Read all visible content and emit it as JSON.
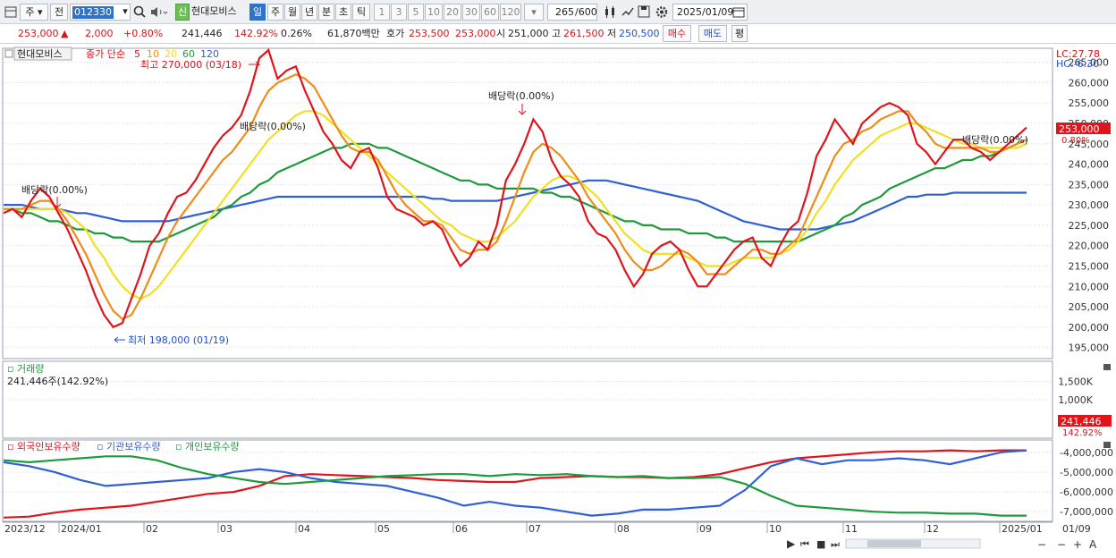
{
  "toolbar": {
    "period_options": [
      "주",
      "전"
    ],
    "stock_code": "012330",
    "badge": "신",
    "stock_name": "현대모비스",
    "intervals": [
      "일",
      "주",
      "월",
      "년",
      "분",
      "초",
      "틱"
    ],
    "interval_active": "일",
    "minute_options": [
      "1",
      "3",
      "5",
      "10",
      "20",
      "30",
      "60",
      "120"
    ],
    "count_current": "265",
    "count_total": "/600",
    "date": "2025/01/09"
  },
  "quote": {
    "price": "253,000",
    "change": "2,000",
    "change_pct": "+0.80%",
    "volume": "241,446",
    "volume_ratio": "142.92%",
    "turnover": "0.26%",
    "amount": "61,870백만",
    "ask_label": "호가",
    "ask": "253,500",
    "bid": "253,000",
    "open_label": "시",
    "open": "251,000",
    "high_label": "고",
    "high": "261,500",
    "low_label": "저",
    "low": "250,500",
    "buy_label": "매수",
    "sell_label": "매도",
    "even_label": "평"
  },
  "chart_data": [
    {
      "type": "candlestick",
      "legend": {
        "name": "현대모비스",
        "items": [
          "종가 단순",
          "5",
          "10",
          "20",
          "60",
          "120"
        ]
      },
      "x_ticks": [
        "2023/12",
        "2024/01",
        "02",
        "03",
        "04",
        "05",
        "06",
        "07",
        "08",
        "09",
        "10",
        "11",
        "12",
        "2025/01",
        "01/09"
      ],
      "y_ticks": [
        "265,000",
        "260,000",
        "255,000",
        "250,000",
        "245,000",
        "240,000",
        "235,000",
        "230,000",
        "225,000",
        "220,000",
        "215,000",
        "210,000",
        "205,000",
        "200,000",
        "195,000"
      ],
      "ylim": [
        192500,
        268000
      ],
      "lc_label": "LC:27.78",
      "hc_label": "HC:-6.30",
      "price_label": "253,000",
      "price_pct": "0.80%",
      "annotations": {
        "high": "최고 270,000 (03/18)",
        "low": "최저 198,000 (01/19)",
        "dividend": "배당락(0.00%)"
      },
      "colors": {
        "up": "#e0141b",
        "down": "#1f4fd1",
        "ma5": "#e0141b",
        "ma10": "#f08c18",
        "ma20": "#f0e020",
        "ma60": "#1e9a3c",
        "ma120": "#2f5fd8"
      },
      "ma5": [
        228000,
        229000,
        227000,
        231000,
        234000,
        232000,
        228000,
        224000,
        219000,
        214000,
        208000,
        203000,
        200000,
        201000,
        207000,
        213000,
        220000,
        223000,
        228000,
        232000,
        233000,
        236000,
        240000,
        244000,
        247000,
        249000,
        252000,
        258000,
        266000,
        268000,
        261000,
        263000,
        264000,
        258000,
        253000,
        248000,
        245000,
        241000,
        239000,
        243000,
        244000,
        239000,
        232000,
        229000,
        228000,
        227000,
        225000,
        226000,
        224000,
        219000,
        215000,
        217000,
        221000,
        219000,
        225000,
        236000,
        240000,
        245000,
        251000,
        248000,
        241000,
        237000,
        235000,
        232000,
        226000,
        223000,
        222000,
        219000,
        214000,
        210000,
        213000,
        218000,
        220000,
        221000,
        219000,
        214000,
        210000,
        210000,
        213000,
        216000,
        219000,
        221000,
        222000,
        217000,
        215000,
        220000,
        224000,
        226000,
        233000,
        242000,
        246000,
        251000,
        248000,
        245000,
        250000,
        252000,
        254000,
        255000,
        254000,
        252000,
        245000,
        243000,
        240000,
        243000,
        246000,
        246000,
        244000,
        243000,
        241000,
        243000,
        245000,
        247000,
        249000
      ],
      "ma10": [
        229000,
        229000,
        229000,
        230000,
        231000,
        231000,
        229000,
        226000,
        222000,
        218000,
        213000,
        208000,
        204000,
        202000,
        203000,
        207000,
        212000,
        217000,
        222000,
        226000,
        229000,
        232000,
        235000,
        238000,
        241000,
        243000,
        246000,
        249000,
        254000,
        258000,
        260000,
        261000,
        262000,
        261000,
        259000,
        255000,
        251000,
        247000,
        244000,
        243000,
        243000,
        241000,
        237000,
        233000,
        230000,
        228000,
        226000,
        226000,
        225000,
        222000,
        219000,
        218000,
        219000,
        219000,
        221000,
        226000,
        232000,
        238000,
        243000,
        245000,
        244000,
        242000,
        239000,
        236000,
        232000,
        229000,
        226000,
        223000,
        219000,
        216000,
        214000,
        214000,
        215000,
        217000,
        219000,
        218000,
        216000,
        213000,
        213000,
        213000,
        215000,
        217000,
        219000,
        219000,
        218000,
        218000,
        220000,
        222000,
        227000,
        232000,
        237000,
        242000,
        245000,
        246000,
        248000,
        249000,
        251000,
        252000,
        253000,
        253000,
        250000,
        248000,
        245000,
        244000,
        244000,
        244000,
        244000,
        244000,
        243000,
        243000,
        244000,
        245000,
        246000
      ],
      "ma20": [
        229000,
        229000,
        229000,
        229000,
        229000,
        229000,
        229000,
        228000,
        226000,
        224000,
        220000,
        217000,
        213000,
        210000,
        208000,
        207000,
        208000,
        210000,
        213000,
        216000,
        219000,
        222000,
        225000,
        228000,
        231000,
        234000,
        237000,
        240000,
        243000,
        246000,
        248000,
        250000,
        252000,
        253000,
        253000,
        252000,
        250000,
        248000,
        246000,
        244000,
        242000,
        240000,
        238000,
        236000,
        234000,
        232000,
        230000,
        228000,
        226000,
        225000,
        223000,
        222000,
        221000,
        221000,
        222000,
        224000,
        226000,
        229000,
        232000,
        234000,
        236000,
        237000,
        237000,
        236000,
        234000,
        232000,
        229000,
        226000,
        223000,
        221000,
        219000,
        218000,
        218000,
        218000,
        218000,
        217000,
        216000,
        215000,
        215000,
        215000,
        216000,
        217000,
        217000,
        217000,
        217000,
        218000,
        219000,
        221000,
        224000,
        228000,
        231000,
        235000,
        238000,
        241000,
        243000,
        245000,
        247000,
        248000,
        249000,
        250000,
        250000,
        249000,
        248000,
        247000,
        246000,
        245000,
        245000,
        244000,
        244000,
        244000,
        244000,
        244000,
        245000
      ],
      "ma60": [
        229000,
        229000,
        228000,
        228000,
        227000,
        226000,
        226000,
        225000,
        224000,
        224000,
        223000,
        223000,
        222000,
        222000,
        221000,
        221000,
        221000,
        221000,
        222000,
        223000,
        224000,
        225000,
        226000,
        227000,
        229000,
        230000,
        232000,
        233000,
        235000,
        236000,
        238000,
        239000,
        240000,
        241000,
        242000,
        243000,
        244000,
        244000,
        245000,
        245000,
        245000,
        244000,
        244000,
        243000,
        242000,
        241000,
        240000,
        239000,
        238000,
        237000,
        236000,
        236000,
        235000,
        235000,
        234000,
        234000,
        234000,
        234000,
        234000,
        233000,
        233000,
        232000,
        232000,
        231000,
        230000,
        229000,
        228000,
        227000,
        226000,
        226000,
        225000,
        225000,
        224000,
        224000,
        224000,
        223000,
        223000,
        223000,
        222000,
        222000,
        221000,
        221000,
        221000,
        221000,
        221000,
        221000,
        221000,
        221000,
        222000,
        223000,
        224000,
        225000,
        227000,
        228000,
        230000,
        231000,
        232000,
        234000,
        235000,
        236000,
        237000,
        238000,
        239000,
        239000,
        240000,
        241000,
        241000,
        242000,
        242000,
        243000,
        244000,
        245000,
        246000
      ],
      "ma120": [
        230000,
        230000,
        230000,
        229500,
        229000,
        229000,
        229000,
        228500,
        228000,
        228000,
        227500,
        227000,
        226500,
        226000,
        226000,
        226000,
        226000,
        226000,
        226000,
        226500,
        227000,
        227500,
        228000,
        228500,
        229000,
        229500,
        230000,
        230500,
        231000,
        231500,
        232000,
        232000,
        232000,
        232000,
        232000,
        232000,
        232000,
        232000,
        232000,
        232000,
        232000,
        232000,
        232000,
        232000,
        232000,
        232000,
        232000,
        231500,
        231500,
        231000,
        231000,
        231000,
        231000,
        231000,
        231000,
        231500,
        232000,
        232500,
        233000,
        233500,
        234000,
        234500,
        235000,
        235500,
        236000,
        236000,
        236000,
        235500,
        235000,
        234500,
        234000,
        233500,
        233000,
        232500,
        232000,
        231500,
        231000,
        230000,
        229000,
        228000,
        227000,
        226000,
        225500,
        225000,
        224500,
        224000,
        224000,
        224000,
        224000,
        224000,
        224500,
        225000,
        225500,
        226000,
        227000,
        228000,
        229000,
        230000,
        231000,
        232000,
        232000,
        232500,
        232500,
        232500,
        233000,
        233000,
        233000,
        233000,
        233000,
        233000,
        233000,
        233000,
        233000
      ]
    },
    {
      "type": "bar",
      "title": "거래량",
      "value_label": "241,446주(142.92%)",
      "y_ticks": [
        "1,500K",
        "1,000K"
      ],
      "ylim": [
        0,
        2000000
      ],
      "current_label": "241,446",
      "current_pct": "142.92%",
      "spike_position": 0.465,
      "typical_fill": 0.12
    },
    {
      "type": "line",
      "legend": [
        "외국인보유수량",
        "기관보유수량",
        "개인보유수량"
      ],
      "colors": [
        "#e0141b",
        "#2f5fd8",
        "#1e9a3c"
      ],
      "y_ticks": [
        "-4,000,000",
        "-5,000,000",
        "-6,000,000",
        "-7,000,000"
      ],
      "ylim": [
        -7400000,
        -3600000
      ],
      "series": [
        {
          "name": "외국인보유수량",
          "values": [
            -7300000,
            -7250000,
            -7050000,
            -6900000,
            -6800000,
            -6700000,
            -6500000,
            -6300000,
            -6100000,
            -6000000,
            -5700000,
            -5200000,
            -5100000,
            -5150000,
            -5200000,
            -5250000,
            -5300000,
            -5400000,
            -5450000,
            -5500000,
            -5500000,
            -5300000,
            -5250000,
            -5200000,
            -5250000,
            -5250000,
            -5300000,
            -5250000,
            -5100000,
            -4800000,
            -4500000,
            -4300000,
            -4200000,
            -4100000,
            -4000000,
            -3950000,
            -3950000,
            -3900000,
            -3950000,
            -3900000,
            -3900000
          ]
        },
        {
          "name": "기관보유수량",
          "values": [
            -4500000,
            -4700000,
            -5000000,
            -5400000,
            -5700000,
            -5600000,
            -5500000,
            -5400000,
            -5300000,
            -5000000,
            -4850000,
            -5000000,
            -5300000,
            -5500000,
            -5600000,
            -5700000,
            -6000000,
            -6300000,
            -6700000,
            -6500000,
            -6700000,
            -6800000,
            -7000000,
            -7200000,
            -7100000,
            -6900000,
            -6900000,
            -6800000,
            -6700000,
            -5900000,
            -4700000,
            -4300000,
            -4600000,
            -4400000,
            -4400000,
            -4300000,
            -4400000,
            -4600000,
            -4300000,
            -4000000,
            -3900000
          ]
        },
        {
          "name": "개인보유수량",
          "values": [
            -4400000,
            -4500000,
            -4400000,
            -4300000,
            -4200000,
            -4200000,
            -4400000,
            -4800000,
            -5100000,
            -5300000,
            -5500000,
            -5600000,
            -5500000,
            -5400000,
            -5300000,
            -5200000,
            -5150000,
            -5100000,
            -5100000,
            -5200000,
            -5100000,
            -5150000,
            -5100000,
            -5200000,
            -5250000,
            -5200000,
            -5300000,
            -5300000,
            -5250000,
            -5600000,
            -6200000,
            -6700000,
            -6800000,
            -6900000,
            -7000000,
            -7050000,
            -7050000,
            -7100000,
            -7100000,
            -7200000,
            -7200000
          ]
        }
      ]
    }
  ]
}
